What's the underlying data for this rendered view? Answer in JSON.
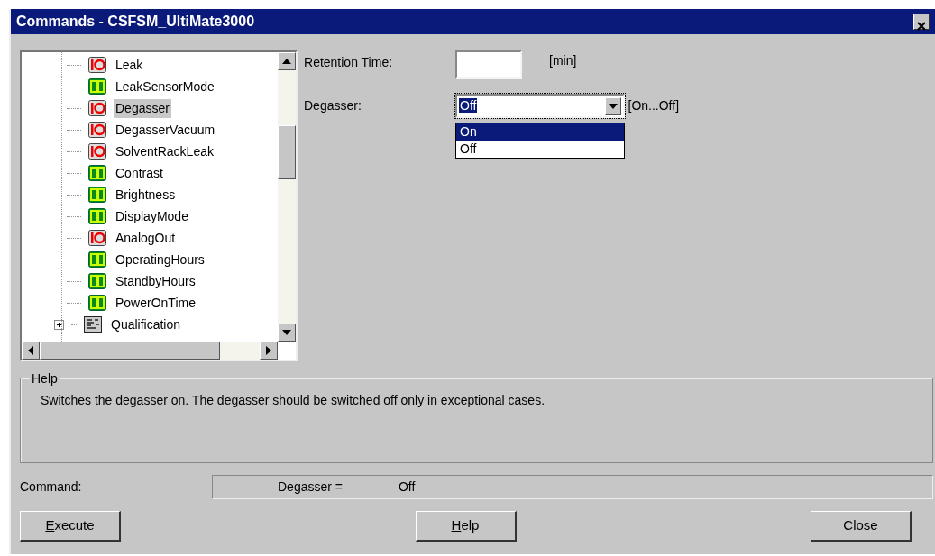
{
  "window": {
    "title": "Commands - CSFSM_UltiMate3000"
  },
  "tree": {
    "items": [
      {
        "label": "Leak",
        "kind": "switch",
        "selected": false
      },
      {
        "label": "LeakSensorMode",
        "kind": "value",
        "selected": false
      },
      {
        "label": "Degasser",
        "kind": "switch",
        "selected": true
      },
      {
        "label": "DegasserVacuum",
        "kind": "switch",
        "selected": false
      },
      {
        "label": "SolventRackLeak",
        "kind": "switch",
        "selected": false
      },
      {
        "label": "Contrast",
        "kind": "value",
        "selected": false
      },
      {
        "label": "Brightness",
        "kind": "value",
        "selected": false
      },
      {
        "label": "DisplayMode",
        "kind": "value",
        "selected": false
      },
      {
        "label": "AnalogOut",
        "kind": "switch",
        "selected": false
      },
      {
        "label": "OperatingHours",
        "kind": "value",
        "selected": false
      },
      {
        "label": "StandbyHours",
        "kind": "value",
        "selected": false
      },
      {
        "label": "PowerOnTime",
        "kind": "value",
        "selected": false
      },
      {
        "label": "Qualification",
        "kind": "folder",
        "selected": false,
        "expanded": false
      }
    ]
  },
  "form": {
    "retention": {
      "label": "Retention Time:",
      "mnemonic": true,
      "unit": "[min]"
    },
    "degasser": {
      "label": "Degasser:",
      "mnemonic": false,
      "value": "Off",
      "range": "[On...Off]",
      "expanded": true,
      "options": [
        {
          "label": "On",
          "highlighted": true
        },
        {
          "label": "Off",
          "highlighted": false
        }
      ]
    }
  },
  "help": {
    "title": "Help",
    "text": "Switches the degasser on. The degasser should be switched off only in exceptional cases."
  },
  "command": {
    "label": "Command:",
    "name": "Degasser =",
    "value": "Off"
  },
  "buttons": [
    {
      "label": "Execute",
      "mnemonic": true
    },
    {
      "label": "Help",
      "mnemonic": true
    },
    {
      "label": "Close",
      "mnemonic": false
    }
  ]
}
